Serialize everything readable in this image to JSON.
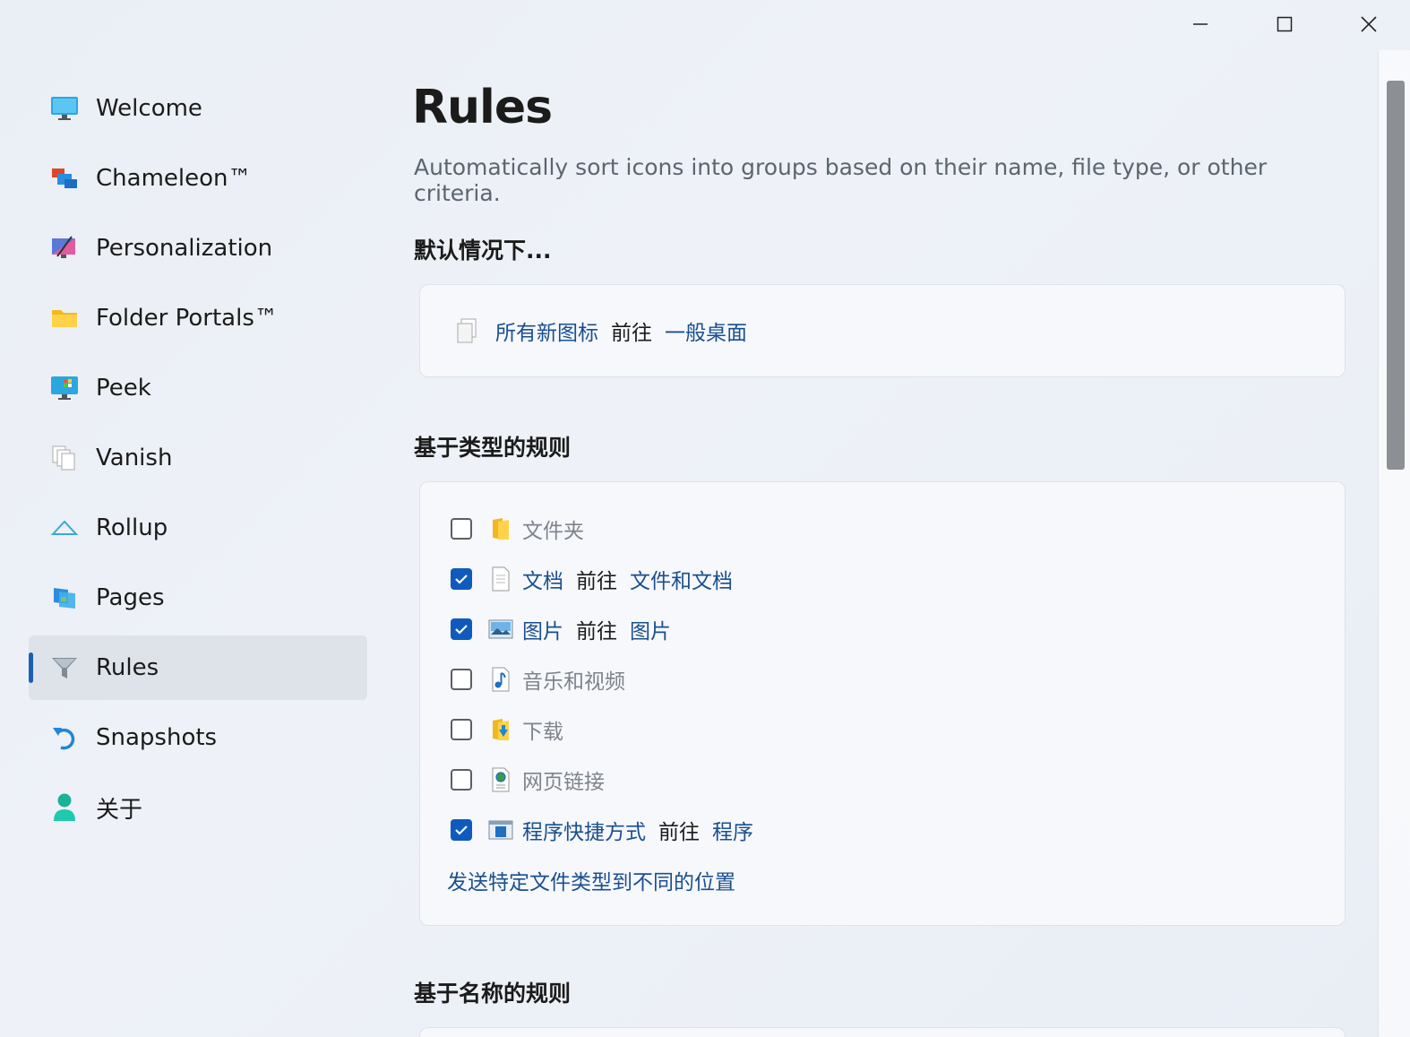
{
  "window": {
    "minimize": "minimize",
    "maximize": "maximize",
    "close": "close"
  },
  "sidebar": {
    "items": [
      {
        "label": "Welcome",
        "icon": "monitor-icon"
      },
      {
        "label": "Chameleon™",
        "icon": "chameleon-icon"
      },
      {
        "label": "Personalization",
        "icon": "personalization-icon"
      },
      {
        "label": "Folder Portals™",
        "icon": "folder-icon"
      },
      {
        "label": "Peek",
        "icon": "peek-icon"
      },
      {
        "label": "Vanish",
        "icon": "vanish-icon"
      },
      {
        "label": "Rollup",
        "icon": "rollup-icon"
      },
      {
        "label": "Pages",
        "icon": "pages-icon"
      },
      {
        "label": "Rules",
        "icon": "funnel-icon",
        "active": true
      },
      {
        "label": "Snapshots",
        "icon": "undo-arrow-icon"
      },
      {
        "label": "关于",
        "icon": "user-icon"
      }
    ]
  },
  "main": {
    "title": "Rules",
    "description": "Automatically sort icons into groups based on their name, file type, or other criteria.",
    "default_section": {
      "heading": "默认情况下...",
      "row": {
        "subject": "所有新图标",
        "verb": "前往",
        "target": "一般桌面"
      }
    },
    "type_section": {
      "heading": "基于类型的规则",
      "rules": [
        {
          "label": "文件夹",
          "checked": false,
          "icon": "folder-icon"
        },
        {
          "label": "文档",
          "checked": true,
          "verb": "前往",
          "target": "文件和文档",
          "icon": "document-icon"
        },
        {
          "label": "图片",
          "checked": true,
          "verb": "前往",
          "target": "图片",
          "icon": "picture-icon"
        },
        {
          "label": "音乐和视频",
          "checked": false,
          "icon": "music-icon"
        },
        {
          "label": "下载",
          "checked": false,
          "icon": "download-folder-icon"
        },
        {
          "label": "网页链接",
          "checked": false,
          "icon": "web-link-icon"
        },
        {
          "label": "程序快捷方式",
          "checked": true,
          "verb": "前往",
          "target": "程序",
          "icon": "program-shortcut-icon"
        }
      ],
      "footer_link": "发送特定文件类型到不同的位置"
    },
    "name_section": {
      "heading": "基于名称的规则"
    }
  },
  "colors": {
    "accent": "#0f5bbd",
    "link": "#1a4f8f",
    "muted": "#7d848c"
  }
}
